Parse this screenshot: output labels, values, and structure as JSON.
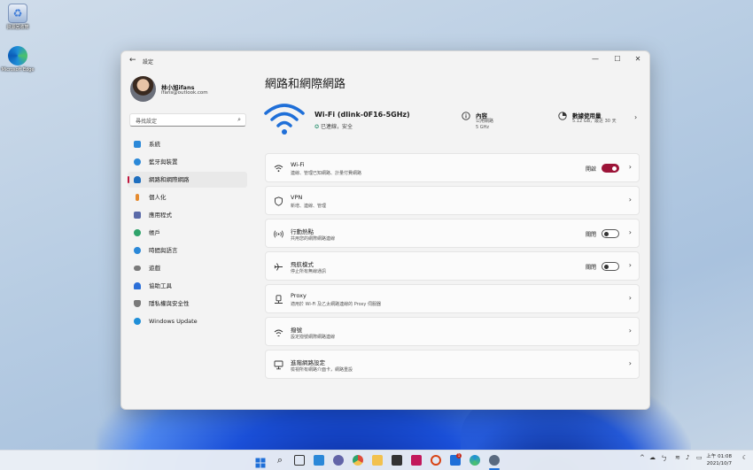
{
  "desktop": {
    "icons": [
      {
        "label": "資源回收筒",
        "icon": "recycle-bin-icon",
        "color": "#3d7bd8"
      },
      {
        "label": "Microsoft Edge",
        "icon": "edge-icon",
        "color": "#1f8fd8"
      }
    ]
  },
  "window": {
    "app_title": "設定",
    "back_icon": "back-arrow-icon",
    "controls": [
      "—",
      "☐",
      "✕"
    ]
  },
  "profile": {
    "name": "林小旭ifans",
    "email": "ifans@outlook.com"
  },
  "search": {
    "placeholder": "尋找設定"
  },
  "sidebar": {
    "items": [
      {
        "label": "系統",
        "icon": "system-icon",
        "color": "#2b88d8"
      },
      {
        "label": "藍牙與裝置",
        "icon": "bluetooth-icon",
        "color": "#2b88d8"
      },
      {
        "label": "網路和網際網路",
        "icon": "network-icon",
        "color": "#1f6fbf",
        "active": true
      },
      {
        "label": "個人化",
        "icon": "brush-icon",
        "color": "#e58a2e"
      },
      {
        "label": "應用程式",
        "icon": "apps-icon",
        "color": "#5a6aa8"
      },
      {
        "label": "帳戶",
        "icon": "account-icon",
        "color": "#2fa36b"
      },
      {
        "label": "時間與語言",
        "icon": "clock-globe-icon",
        "color": "#2b88d8"
      },
      {
        "label": "遊戲",
        "icon": "gamepad-icon",
        "color": "#7a7a7a"
      },
      {
        "label": "協助工具",
        "icon": "accessibility-icon",
        "color": "#2b6fd8"
      },
      {
        "label": "隱私權與安全性",
        "icon": "shield-icon",
        "color": "#7a7a7a"
      },
      {
        "label": "Windows Update",
        "icon": "update-icon",
        "color": "#1f8fd8"
      }
    ]
  },
  "main": {
    "title": "網路和網際網路",
    "network": {
      "name": "Wi-Fi (dlink-0F16-5GHz)",
      "status": "已連線，安全"
    },
    "properties": {
      "title": "內容",
      "line1": "公用網路",
      "line2": "5 GHz"
    },
    "data_usage": {
      "title": "數據使用量",
      "detail": "5.12 GB，最近 30 天"
    },
    "cards": [
      {
        "title": "Wi-Fi",
        "subtitle": "連線、管理已知網路、計量付費網路",
        "icon": "wifi-icon",
        "state": "開啟",
        "toggle": true,
        "on": true
      },
      {
        "title": "VPN",
        "subtitle": "新增、連線、管理",
        "icon": "vpn-shield-icon",
        "state": "",
        "toggle": false,
        "on": false
      },
      {
        "title": "行動熱點",
        "subtitle": "共用您的網際網路連線",
        "icon": "hotspot-icon",
        "state": "關閉",
        "toggle": true,
        "on": false
      },
      {
        "title": "飛航模式",
        "subtitle": "停止所有無線通訊",
        "icon": "airplane-icon",
        "state": "關閉",
        "toggle": true,
        "on": false
      },
      {
        "title": "Proxy",
        "subtitle": "適用於 Wi-Fi 及乙太網路連線的 Proxy 伺服器",
        "icon": "proxy-icon",
        "state": "",
        "toggle": false,
        "on": false
      },
      {
        "title": "撥號",
        "subtitle": "設定撥號網際網路連線",
        "icon": "dialup-icon",
        "state": "",
        "toggle": false,
        "on": false
      },
      {
        "title": "進階網路設定",
        "subtitle": "檢視所有網路介面卡，網路重設",
        "icon": "advanced-network-icon",
        "state": "",
        "toggle": false,
        "on": false
      }
    ]
  },
  "taskbar": {
    "apps": [
      {
        "icon": "windows-start-icon",
        "color": "#1f6fd8"
      },
      {
        "icon": "search-icon",
        "color": "#333333"
      },
      {
        "icon": "task-view-icon",
        "color": "#333333"
      },
      {
        "icon": "widgets-icon",
        "color": "#2b88d8"
      },
      {
        "icon": "teams-chat-icon",
        "color": "#6264a7"
      },
      {
        "icon": "chrome-icon",
        "color": "#dd4b39"
      },
      {
        "icon": "file-explorer-icon",
        "color": "#f2c14e"
      },
      {
        "icon": "store-icon",
        "color": "#333333"
      },
      {
        "icon": "app-red-icon",
        "color": "#c2185b"
      },
      {
        "icon": "app-circle-icon",
        "color": "#d84315"
      },
      {
        "icon": "mail-icon",
        "color": "#1f6fd8"
      },
      {
        "icon": "edge-icon",
        "color": "#1f8fd8"
      },
      {
        "icon": "settings-gear-icon",
        "color": "#5a6a80"
      }
    ],
    "mail_badge": "1",
    "tray_arrow": "^",
    "time": "上午 01:08",
    "date": "2021/10/7"
  }
}
